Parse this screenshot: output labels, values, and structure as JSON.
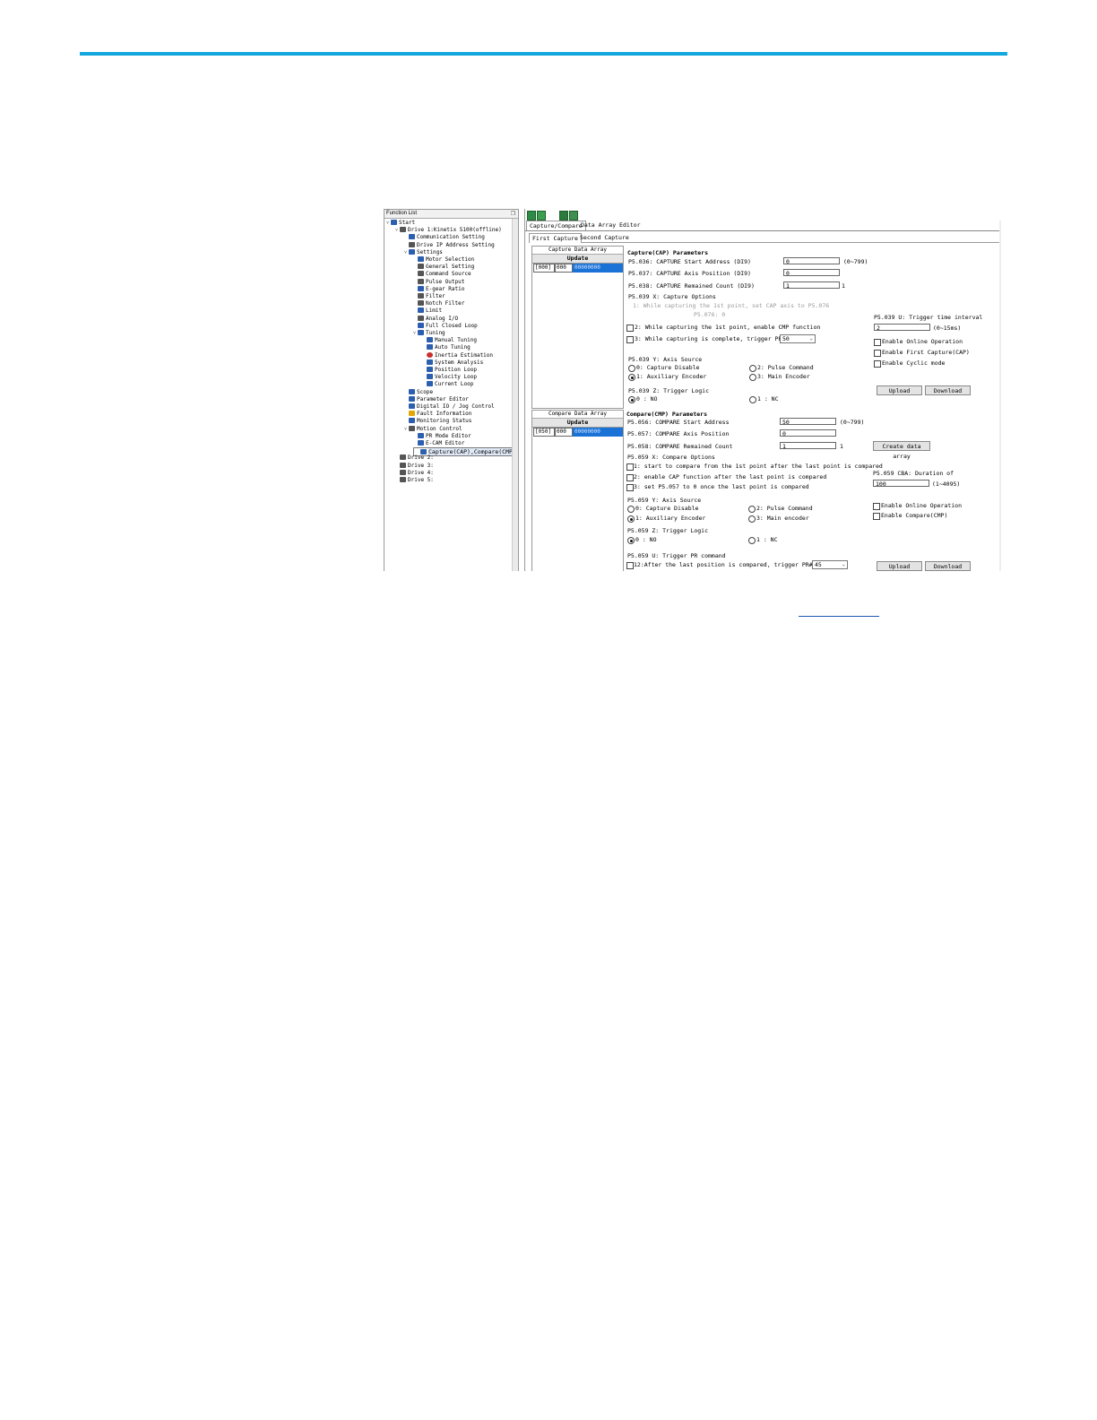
{
  "function_list": {
    "title": "Function List",
    "pin": "❐",
    "tree": [
      {
        "label": "Start",
        "ind": 0,
        "tog": "˅",
        "icon": "blue"
      },
      {
        "label": "Drive 1:Kinetix 5100(offline)",
        "ind": 1,
        "tog": "˅",
        "icon": "gray"
      },
      {
        "label": "Communication Setting",
        "ind": 2,
        "icon": "blue"
      },
      {
        "label": "Drive IP Address Setting",
        "ind": 2,
        "icon": "gray"
      },
      {
        "label": "Settings",
        "ind": 2,
        "tog": "˅",
        "icon": "blue"
      },
      {
        "label": "Motor Selection",
        "ind": 3,
        "icon": "blue"
      },
      {
        "label": "General Setting",
        "ind": 3,
        "icon": "gray"
      },
      {
        "label": "Command Source",
        "ind": 3,
        "icon": "gray"
      },
      {
        "label": "Pulse Output",
        "ind": 3,
        "icon": "gray"
      },
      {
        "label": "E-gear Ratio",
        "ind": 3,
        "icon": "blue"
      },
      {
        "label": "Filter",
        "ind": 3,
        "icon": "gray"
      },
      {
        "label": "Notch Filter",
        "ind": 3,
        "icon": "gray"
      },
      {
        "label": "Limit",
        "ind": 3,
        "icon": "blue"
      },
      {
        "label": "Analog I/O",
        "ind": 3,
        "icon": "gray"
      },
      {
        "label": "Full Closed Loop",
        "ind": 3,
        "icon": "blue"
      },
      {
        "label": "Tuning",
        "ind": 3,
        "tog": "˅",
        "icon": "blue"
      },
      {
        "label": "Manual Tuning",
        "ind": 4,
        "icon": "blue"
      },
      {
        "label": "Auto Tuning",
        "ind": 4,
        "icon": "blue"
      },
      {
        "label": "Inertia Estimation",
        "ind": 4,
        "icon": "red"
      },
      {
        "label": "System Analysis",
        "ind": 4,
        "icon": "blue"
      },
      {
        "label": "Position Loop",
        "ind": 4,
        "icon": "blue"
      },
      {
        "label": "Velocity Loop",
        "ind": 4,
        "icon": "blue"
      },
      {
        "label": "Current Loop",
        "ind": 4,
        "icon": "blue"
      },
      {
        "label": "Scope",
        "ind": 2,
        "icon": "blue"
      },
      {
        "label": "Parameter Editor",
        "ind": 2,
        "icon": "blue"
      },
      {
        "label": "Digital IO / Jog Control",
        "ind": 2,
        "icon": "blue"
      },
      {
        "label": "Fault Information",
        "ind": 2,
        "icon": "y"
      },
      {
        "label": "Monitoring Status",
        "ind": 2,
        "icon": "blue"
      },
      {
        "label": "Motion Control",
        "ind": 2,
        "tog": "˅",
        "icon": "gray"
      },
      {
        "label": "PR Mode Editor",
        "ind": 3,
        "icon": "blue"
      },
      {
        "label": "E-CAM Editor",
        "ind": 3,
        "icon": "blue"
      },
      {
        "label": "Capture(CAP),Compare(CMP)",
        "ind": 3,
        "icon": "blue",
        "sel": true
      },
      {
        "label": "Drive 2:",
        "ind": 1,
        "icon": "gray"
      },
      {
        "label": "Drive 3:",
        "ind": 1,
        "icon": "gray"
      },
      {
        "label": "Drive 4:",
        "ind": 1,
        "icon": "gray"
      },
      {
        "label": "Drive 5:",
        "ind": 1,
        "icon": "gray"
      }
    ]
  },
  "tabs": {
    "capture_compare": "Capture/Compare",
    "data_array_editor": "Data Array Editor"
  },
  "subtabs": {
    "first": "First Capture",
    "second": "Second Capture"
  },
  "capture_array": {
    "title": "Capture Data Array",
    "update": "Update",
    "idx": "[000]",
    "val": "000",
    "hex": "00000000"
  },
  "compare_array": {
    "title": "Compare Data Array",
    "update": "Update",
    "idx": "[050]",
    "val": "000",
    "hex": "00000000"
  },
  "cap": {
    "header": "Capture(CAP) Parameters",
    "p036": "P5.036: CAPTURE Start Address (DI9)",
    "p036_val": "0",
    "p036_range": "(0~799)",
    "p037": "P5.037: CAPTURE Axis Position (DI9)",
    "p037_val": "0",
    "p038": "P5.038: CAPTURE Remained Count (DI9)",
    "p038_val": "1",
    "p038_suffix": "1",
    "opt_header": "P5.039 X: Capture Options",
    "opt1": "1: While capturing the 1st point, set CAP axis to P5.076",
    "p5076": "P5.076: 0",
    "opt2": "2: While capturing the 1st point, enable CMP function",
    "opt3": "3: While capturing is complete, trigger PR#",
    "pr_val": "50",
    "interval_header": "P5.039 U: Trigger time interval",
    "interval_val": "2",
    "interval_range": "(0~15ms)",
    "en_online": "Enable Online Operation",
    "en_first": "Enable First Capture(CAP)",
    "en_cyclic": "Enable Cyclic mode",
    "y_header": "P5.039 Y: Axis Source",
    "y0": "0: Capture Disable",
    "y1": "1: Auxiliary Encoder",
    "y2": "2: Pulse Command",
    "y3": "3: Main Encoder",
    "z_header": "P5.039 Z: Trigger Logic",
    "z0": "0 : NO",
    "z1": "1 : NC",
    "upload": "Upload",
    "download": "Download"
  },
  "cmp": {
    "header": "Compare(CMP) Parameters",
    "p056": "P5.056: COMPARE Start Address",
    "p056_val": "50",
    "p056_range": "(0~799)",
    "p057": "P5.057: COMPARE Axis Position",
    "p057_val": "0",
    "p058": "P5.058: COMPARE Remained Count",
    "p058_val": "1",
    "p058_suffix": "1",
    "create": "Create data array",
    "opt_header": "P5.059 X: Compare Options",
    "opt1": "1: start to compare from the 1st point after the last point is compared",
    "opt2": "2: enable CAP function after the last point is compared",
    "opt3": "3: set P5.057 to 0 once the last point is compared",
    "cba_header": "P5.059 CBA: Duration of",
    "cba_val": "100",
    "cba_range": "(1~4095)",
    "y_header": "P5.059 Y: Axis Source",
    "y0": "0: Capture Disable",
    "y1": "1: Auxiliary Encoder",
    "y2": "2: Pulse Command",
    "y3": "3: Main encoder",
    "en_online": "Enable Online Operation",
    "en_cmp": "Enable Compare(CMP)",
    "z_header": "P5.059 Z: Trigger Logic",
    "z0": "0 : NO",
    "z1": "1 : NC",
    "u_header": "P5.059 U: Trigger PR command",
    "u1": "12:After the last position is compared, trigger PR#",
    "pr_val": "45",
    "upload": "Upload",
    "download": "Download"
  },
  "colors": {
    "rule": "#14a7df",
    "selection": "#1a72d6"
  }
}
